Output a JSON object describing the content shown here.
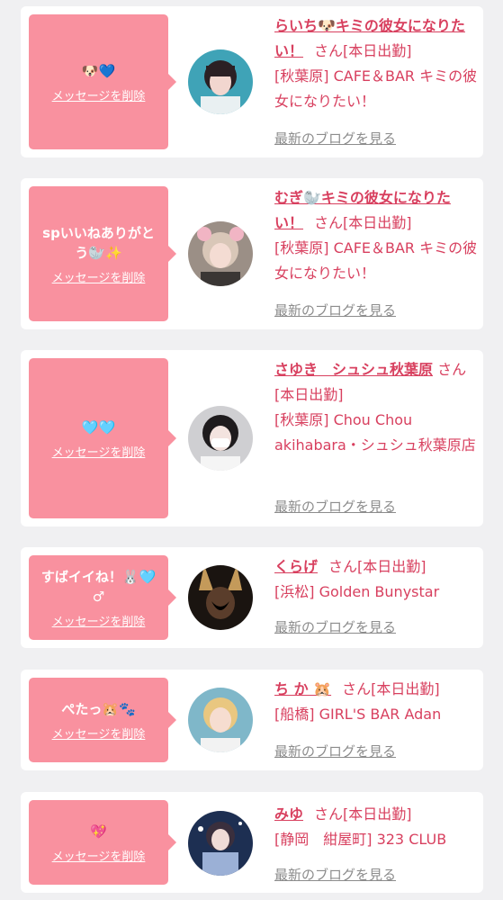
{
  "delete_label": "メッセージを削除",
  "blog_label": "最新のブログを見る",
  "cards": [
    {
      "message": "🐶💙",
      "name": "らいち🐶キミの彼女になりたい！",
      "suffix": "さん[本日出勤]",
      "shop": "[秋葉原] CAFE＆BAR キミの彼女になりたい！"
    },
    {
      "message": "spいいねありがとう🦭✨",
      "name": "むぎ🦭キミの彼女になりたい！",
      "suffix": "さん[本日出勤]",
      "shop": "[秋葉原] CAFE＆BAR キミの彼女になりたい！"
    },
    {
      "message": "🩵🩵",
      "name": "さゆき　シュシュ秋葉原",
      "suffix": "さん[本日出勤]",
      "shop": "[秋葉原] Chou Chou akihabara・シュシュ秋葉原店"
    },
    {
      "message": "すばイイね！🐰🩵♂",
      "name": "くらげ",
      "suffix": "さん[本日出勤]",
      "shop": "[浜松] Golden Bunystar"
    },
    {
      "message": "ぺたっ🐹🐾",
      "name": "ち か 🐹",
      "suffix": "さん[本日出勤]",
      "shop": "[船橋] GIRL'S BAR Adan"
    },
    {
      "message": "💖",
      "name": "みゆ",
      "suffix": "さん[本日出勤]",
      "shop": "[静岡　紺屋町] 323 CLUB"
    }
  ],
  "colors": {
    "background": "#f0f0f2",
    "bubble": "#f9919f",
    "accent": "#d8405f",
    "muted": "#8c8c8c"
  }
}
